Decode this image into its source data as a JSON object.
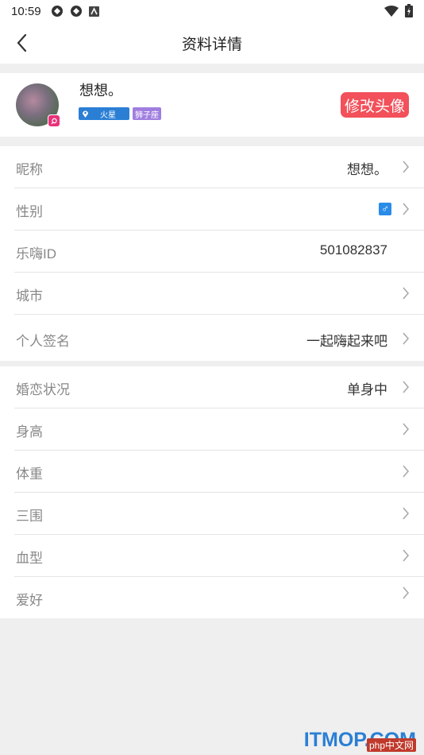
{
  "status_bar": {
    "time": "10:59"
  },
  "nav": {
    "title": "资料详情"
  },
  "profile": {
    "nickname": "想想。",
    "tags": {
      "location": "火星",
      "zodiac": "狮子座"
    },
    "change_avatar_label": "修改头像"
  },
  "section1": {
    "rows": [
      {
        "label": "昵称",
        "value": "想想。"
      },
      {
        "label": "性别",
        "value": "♂"
      },
      {
        "label": "乐嗨ID",
        "value": "501082837"
      },
      {
        "label": "城市",
        "value": ""
      },
      {
        "label": "个人签名",
        "value": "一起嗨起来吧"
      }
    ]
  },
  "section2": {
    "rows": [
      {
        "label": "婚恋状况",
        "value": "单身中"
      },
      {
        "label": "身高",
        "value": ""
      },
      {
        "label": "体重",
        "value": ""
      },
      {
        "label": "三围",
        "value": ""
      },
      {
        "label": "血型",
        "value": ""
      },
      {
        "label": "爱好",
        "value": ""
      }
    ]
  },
  "watermark": {
    "main": "ITMOP.COM",
    "sub": "php中文网"
  }
}
